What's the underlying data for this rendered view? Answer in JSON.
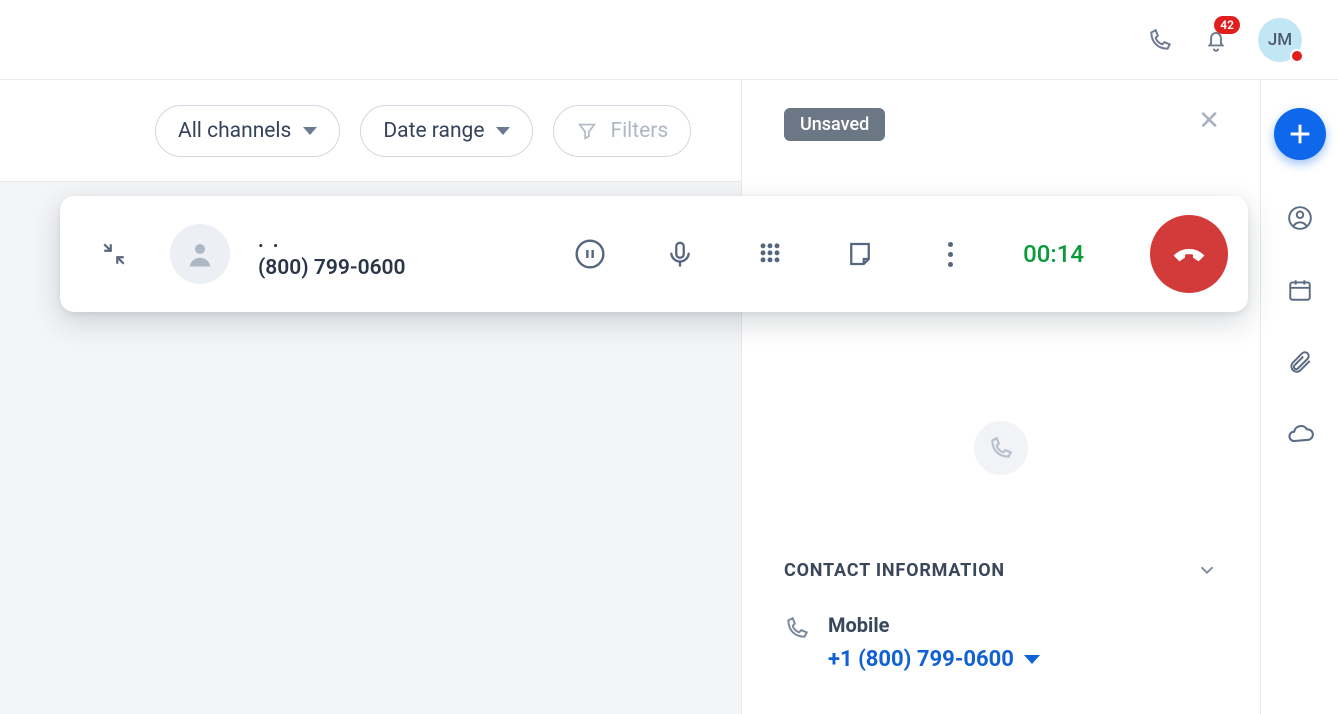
{
  "header": {
    "notification_count": "42",
    "avatar_initials": "JM"
  },
  "filters": {
    "channels_label": "All channels",
    "date_label": "Date range",
    "filters_label": "Filters"
  },
  "detail": {
    "status_chip": "Unsaved",
    "section_title": "CONTACT INFORMATION",
    "phone_type_label": "Mobile",
    "phone_value": "+1 (800) 799-0600"
  },
  "call": {
    "name": ". .",
    "number": "(800) 799-0600",
    "timer": "00:14"
  }
}
